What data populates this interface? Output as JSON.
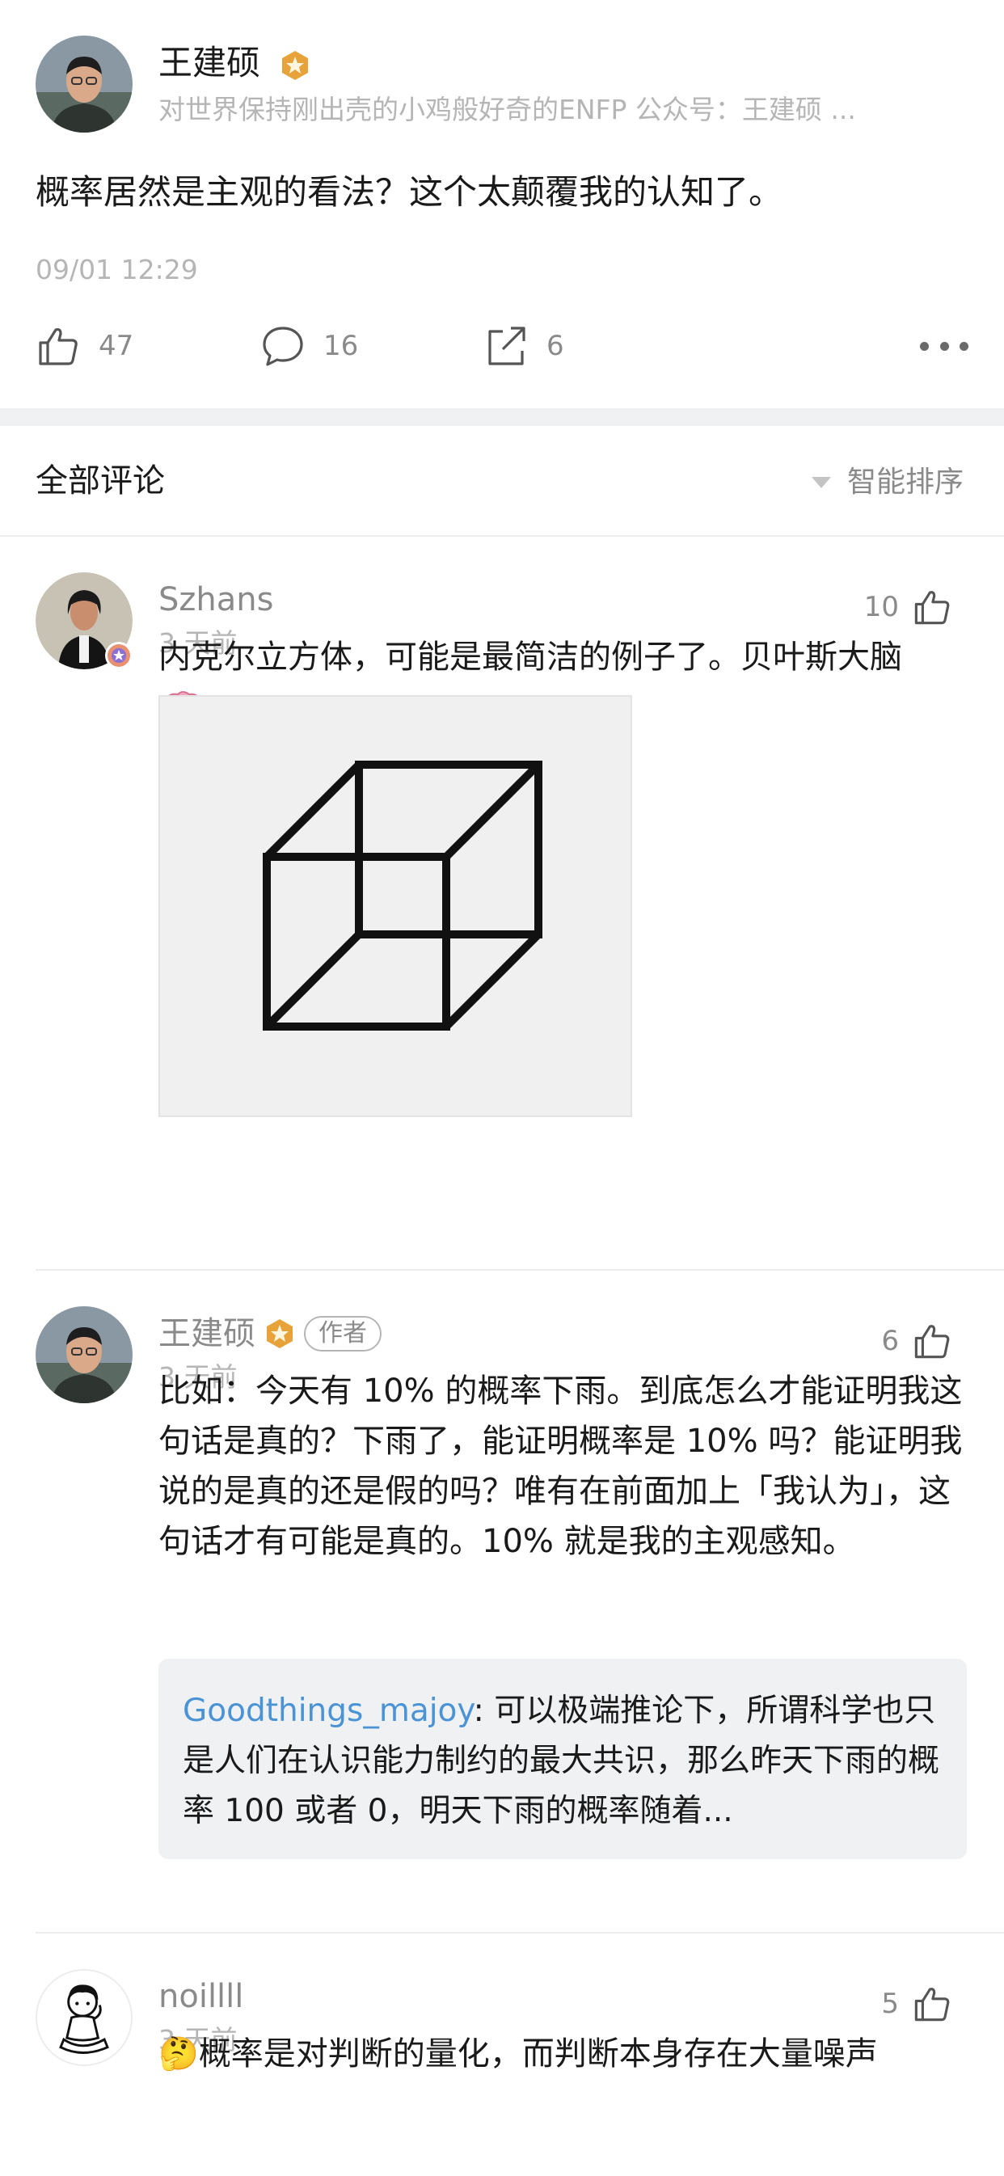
{
  "post": {
    "author": "王建硕",
    "bio": "对世界保持刚出壳的小鸡般好奇的ENFP   公众号：王建硕 ...",
    "text": "概率居然是主观的看法？这个太颠覆我的认知了。",
    "time": "09/01 12:29",
    "likes": "47",
    "comments": "16",
    "shares": "6"
  },
  "comments_header": {
    "title": "全部评论",
    "sort": "智能排序"
  },
  "comments": [
    {
      "user": "Szhans",
      "time": "3 天前",
      "likes": "10",
      "text": "内克尔立方体，可能是最简洁的例子了。贝叶斯大脑"
    },
    {
      "user": "王建硕",
      "tag": "作者",
      "time": "3 天前",
      "likes": "6",
      "text": "比如：今天有 10% 的概率下雨。到底怎么才能证明我这句话是真的？下雨了，能证明概率是 10% 吗？能证明我说的是真的还是假的吗？唯有在前面加上「我认为」，这句话才有可能是真的。10% 就是我的主观感知。",
      "reply": {
        "user": "Goodthings_majoy",
        "text": ": 可以极端推论下，所谓科学也只是人们在认识能力制约的最大共识，那么昨天下雨的概率 100 或者 0，明天下雨的概率随着..."
      }
    },
    {
      "user": "noillll",
      "time": "3 天前",
      "likes": "5",
      "emoji": "🤔",
      "text": "概率是对判断的量化，而判断本身存在大量噪声"
    }
  ],
  "icons": {
    "like": "thumbs-up-icon",
    "comment": "speech-bubble-icon",
    "share": "share-icon",
    "more": "more-dots-icon",
    "badge": "gold-star-badge-icon",
    "brain": "brain-emoji",
    "thinking": "thinking-face-emoji"
  },
  "colors": {
    "link": "#4a94d6",
    "muted": "#8a8a8a",
    "badge": "#e8a23a",
    "separator": "#f0f1f3"
  }
}
